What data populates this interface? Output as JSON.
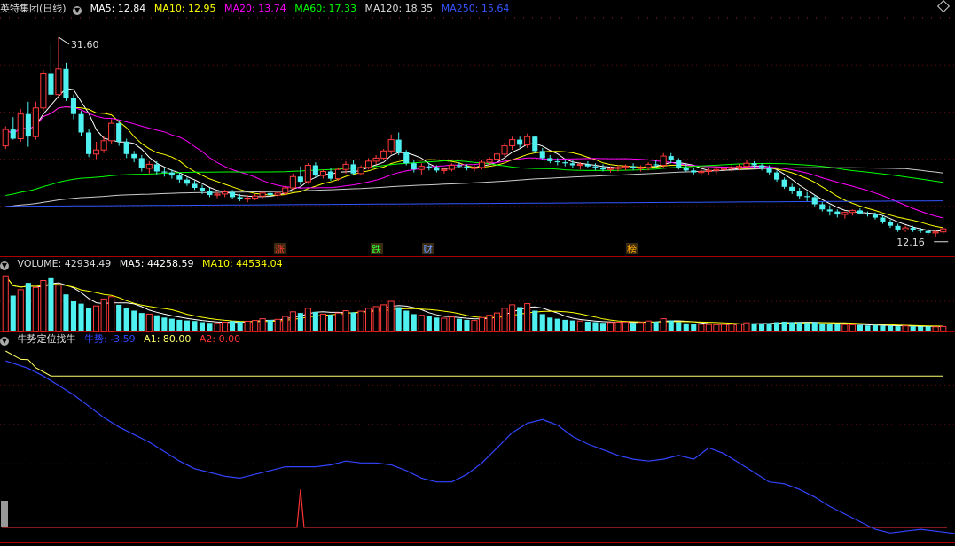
{
  "chart_data": [
    {
      "type": "candlestick",
      "title": "英特集团(日线)",
      "indicators": [
        {
          "label": "MA5: 12.84",
          "color": "#ffffff"
        },
        {
          "label": "MA10: 12.95",
          "color": "#ffff00"
        },
        {
          "label": "MA20: 13.74",
          "color": "#ff00ff"
        },
        {
          "label": "MA60: 17.33",
          "color": "#00ff00"
        },
        {
          "label": "MA120: 18.35",
          "color": "#dddddd"
        },
        {
          "label": "MA250: 15.64",
          "color": "#3355ff"
        }
      ],
      "high_label": "31.60",
      "low_label": "12.16",
      "event_markers": [
        {
          "label": "涨",
          "color": "#ff3333"
        },
        {
          "label": "跌",
          "color": "#33ff33"
        },
        {
          "label": "财",
          "color": "#6699ff"
        },
        {
          "label": "榜",
          "color": "#ffaa00"
        }
      ],
      "ylim": [
        10.5,
        33.5
      ],
      "ohlc": [
        [
          21.0,
          22.9,
          20.7,
          22.6
        ],
        [
          22.6,
          23.8,
          21.6,
          21.7
        ],
        [
          21.7,
          24.6,
          21.4,
          24.1
        ],
        [
          24.1,
          25.3,
          20.9,
          21.9
        ],
        [
          21.9,
          25.3,
          21.6,
          24.7
        ],
        [
          24.7,
          28.4,
          24.4,
          28.1
        ],
        [
          28.1,
          30.9,
          25.8,
          26.0
        ],
        [
          26.0,
          31.6,
          25.8,
          28.5
        ],
        [
          28.5,
          29.1,
          25.4,
          25.7
        ],
        [
          25.7,
          26.0,
          23.6,
          24.1
        ],
        [
          24.1,
          24.4,
          22.0,
          22.3
        ],
        [
          22.3,
          22.6,
          19.9,
          20.2
        ],
        [
          20.2,
          21.4,
          19.7,
          20.6
        ],
        [
          20.6,
          21.9,
          20.3,
          21.5
        ],
        [
          21.5,
          23.6,
          21.2,
          23.2
        ],
        [
          23.2,
          23.5,
          21.0,
          21.4
        ],
        [
          21.4,
          21.7,
          19.8,
          20.2
        ],
        [
          20.2,
          20.5,
          19.4,
          19.8
        ],
        [
          19.8,
          20.1,
          18.5,
          18.8
        ],
        [
          18.8,
          19.5,
          18.3,
          19.2
        ],
        [
          19.2,
          19.5,
          18.2,
          18.5
        ],
        [
          18.5,
          18.8,
          18.0,
          18.4
        ],
        [
          18.4,
          18.7,
          17.8,
          18.1
        ],
        [
          18.1,
          18.4,
          17.4,
          17.7
        ],
        [
          17.7,
          17.9,
          17.1,
          17.3
        ],
        [
          17.3,
          17.6,
          16.7,
          16.9
        ],
        [
          16.9,
          17.2,
          16.3,
          16.6
        ],
        [
          16.6,
          16.9,
          16.0,
          16.2
        ],
        [
          16.2,
          16.5,
          15.9,
          16.3
        ],
        [
          16.3,
          16.7,
          16.0,
          16.5
        ],
        [
          16.5,
          16.7,
          15.8,
          16.0
        ],
        [
          16.0,
          16.3,
          15.6,
          15.8
        ],
        [
          15.8,
          16.2,
          15.5,
          15.9
        ],
        [
          15.9,
          16.3,
          15.7,
          16.1
        ],
        [
          16.1,
          16.6,
          15.9,
          16.4
        ],
        [
          16.4,
          16.7,
          16.0,
          16.2
        ],
        [
          16.2,
          16.6,
          15.9,
          16.4
        ],
        [
          16.4,
          17.1,
          16.2,
          16.9
        ],
        [
          16.9,
          18.3,
          16.7,
          18.0
        ],
        [
          18.0,
          19.0,
          17.2,
          17.5
        ],
        [
          17.5,
          19.3,
          17.3,
          19.1
        ],
        [
          19.1,
          19.4,
          17.9,
          18.1
        ],
        [
          18.1,
          18.7,
          17.8,
          18.5
        ],
        [
          18.5,
          18.8,
          17.6,
          17.8
        ],
        [
          17.8,
          18.9,
          17.6,
          18.7
        ],
        [
          18.7,
          19.5,
          18.3,
          19.2
        ],
        [
          19.2,
          19.6,
          18.1,
          18.3
        ],
        [
          18.3,
          19.1,
          18.1,
          18.9
        ],
        [
          18.9,
          19.8,
          18.7,
          19.5
        ],
        [
          19.5,
          20.1,
          19.2,
          19.8
        ],
        [
          19.8,
          20.7,
          19.6,
          20.5
        ],
        [
          20.5,
          22.1,
          20.2,
          21.6
        ],
        [
          21.6,
          22.3,
          20.1,
          20.4
        ],
        [
          20.4,
          20.6,
          19.1,
          19.3
        ],
        [
          19.3,
          19.6,
          18.4,
          18.7
        ],
        [
          18.7,
          19.3,
          18.2,
          19.0
        ],
        [
          19.0,
          19.3,
          18.6,
          18.9
        ],
        [
          18.9,
          19.1,
          18.4,
          18.6
        ],
        [
          18.6,
          18.9,
          18.3,
          18.7
        ],
        [
          18.7,
          19.3,
          18.5,
          19.1
        ],
        [
          19.1,
          19.4,
          18.8,
          19.0
        ],
        [
          19.0,
          19.2,
          18.6,
          18.8
        ],
        [
          18.8,
          19.1,
          18.5,
          18.9
        ],
        [
          18.9,
          19.6,
          18.7,
          19.4
        ],
        [
          19.4,
          19.9,
          19.1,
          19.7
        ],
        [
          19.7,
          20.4,
          19.5,
          20.2
        ],
        [
          20.2,
          21.3,
          19.9,
          21.0
        ],
        [
          21.0,
          21.9,
          20.6,
          21.6
        ],
        [
          21.6,
          21.9,
          20.8,
          21.1
        ],
        [
          21.1,
          22.2,
          20.8,
          21.9
        ],
        [
          21.9,
          22.0,
          20.3,
          20.5
        ],
        [
          20.5,
          20.8,
          19.6,
          19.8
        ],
        [
          19.8,
          20.1,
          19.3,
          19.5
        ],
        [
          19.5,
          19.8,
          19.1,
          19.4
        ],
        [
          19.4,
          19.7,
          19.0,
          19.3
        ],
        [
          19.3,
          19.6,
          18.8,
          19.1
        ],
        [
          19.1,
          19.4,
          18.7,
          19.2
        ],
        [
          19.2,
          19.5,
          18.9,
          19.0
        ],
        [
          19.0,
          19.3,
          18.6,
          18.9
        ],
        [
          18.9,
          19.2,
          18.5,
          18.7
        ],
        [
          18.7,
          19.0,
          18.4,
          18.8
        ],
        [
          18.8,
          19.1,
          18.5,
          18.9
        ],
        [
          18.9,
          19.2,
          18.6,
          19.0
        ],
        [
          19.0,
          19.3,
          18.6,
          18.8
        ],
        [
          18.8,
          19.1,
          18.5,
          18.9
        ],
        [
          18.9,
          19.4,
          18.6,
          19.2
        ],
        [
          19.2,
          19.6,
          18.9,
          19.1
        ],
        [
          19.1,
          20.3,
          18.8,
          20.0
        ],
        [
          20.0,
          20.3,
          19.3,
          19.6
        ],
        [
          19.6,
          19.8,
          18.7,
          18.9
        ],
        [
          18.9,
          19.2,
          18.5,
          18.6
        ],
        [
          18.6,
          18.8,
          18.2,
          18.4
        ],
        [
          18.4,
          18.7,
          18.1,
          18.5
        ],
        [
          18.5,
          18.8,
          18.2,
          18.6
        ],
        [
          18.6,
          18.9,
          18.3,
          18.7
        ],
        [
          18.7,
          19.0,
          18.4,
          18.8
        ],
        [
          18.8,
          19.1,
          18.5,
          18.9
        ],
        [
          18.9,
          19.2,
          18.6,
          19.0
        ],
        [
          19.0,
          19.6,
          18.8,
          19.3
        ],
        [
          19.3,
          19.5,
          18.9,
          19.1
        ],
        [
          19.1,
          19.3,
          18.6,
          18.9
        ],
        [
          18.9,
          19.1,
          18.2,
          18.4
        ],
        [
          18.4,
          18.6,
          17.5,
          17.7
        ],
        [
          17.7,
          17.9,
          16.8,
          17.0
        ],
        [
          17.0,
          17.3,
          16.3,
          16.6
        ],
        [
          16.6,
          16.9,
          15.8,
          16.1
        ],
        [
          16.1,
          16.5,
          15.6,
          16.0
        ],
        [
          16.0,
          16.2,
          15.1,
          15.3
        ],
        [
          15.3,
          15.5,
          14.6,
          14.8
        ],
        [
          14.8,
          15.2,
          14.2,
          14.6
        ],
        [
          14.6,
          14.8,
          14.0,
          14.3
        ],
        [
          14.3,
          14.6,
          13.9,
          14.5
        ],
        [
          14.5,
          14.8,
          14.2,
          14.7
        ],
        [
          14.7,
          14.9,
          14.3,
          14.4
        ],
        [
          14.4,
          14.6,
          14.1,
          14.3
        ],
        [
          14.3,
          14.5,
          13.8,
          14.0
        ],
        [
          14.0,
          14.2,
          13.4,
          13.6
        ],
        [
          13.6,
          13.8,
          13.0,
          13.2
        ],
        [
          13.2,
          13.4,
          12.6,
          12.8
        ],
        [
          12.8,
          13.2,
          12.6,
          13.0
        ],
        [
          13.0,
          13.2,
          12.6,
          12.8
        ],
        [
          12.8,
          13.0,
          12.5,
          12.7
        ],
        [
          12.7,
          12.9,
          12.3,
          12.5
        ],
        [
          12.5,
          12.8,
          12.16,
          12.6
        ],
        [
          12.6,
          13.0,
          12.4,
          12.9
        ]
      ],
      "ma250": {
        "start": 15.1,
        "end": 15.64
      }
    },
    {
      "type": "bar",
      "title": "VOLUME",
      "indicators": [
        {
          "label": "VOLUME: 42934.49",
          "color": "#dddddd"
        },
        {
          "label": "MA5: 44258.59",
          "color": "#ffffff"
        },
        {
          "label": "MA10: 44534.04",
          "color": "#ffff00"
        }
      ],
      "ylim": [
        0,
        520000
      ],
      "values": [
        480000,
        310000,
        360000,
        420000,
        380000,
        440000,
        460000,
        400000,
        320000,
        260000,
        240000,
        200000,
        220000,
        280000,
        300000,
        230000,
        200000,
        180000,
        160000,
        150000,
        140000,
        120000,
        110000,
        100000,
        95000,
        90000,
        80000,
        75000,
        70000,
        80000,
        90000,
        85000,
        88000,
        95000,
        110000,
        100000,
        105000,
        130000,
        170000,
        160000,
        200000,
        170000,
        150000,
        145000,
        160000,
        180000,
        165000,
        175000,
        200000,
        215000,
        230000,
        260000,
        210000,
        180000,
        150000,
        140000,
        130000,
        120000,
        115000,
        125000,
        110000,
        100000,
        95000,
        120000,
        140000,
        160000,
        200000,
        230000,
        210000,
        240000,
        180000,
        150000,
        120000,
        110000,
        100000,
        95000,
        90000,
        85000,
        80000,
        75000,
        78000,
        80000,
        82000,
        75000,
        78000,
        90000,
        85000,
        110000,
        95000,
        80000,
        70000,
        65000,
        62000,
        60000,
        58000,
        60000,
        62000,
        64000,
        75000,
        70000,
        68000,
        72000,
        80000,
        85000,
        80000,
        78000,
        75000,
        80000,
        70000,
        68000,
        65000,
        60000,
        58000,
        55000,
        52000,
        55000,
        50000,
        48000,
        45000,
        48000,
        44000,
        42000,
        43000,
        40000,
        42934
      ]
    },
    {
      "type": "line",
      "title": "牛势定位找牛",
      "indicators": [
        {
          "label": "牛势: -3.59",
          "color": "#3344ff"
        },
        {
          "label": "A1: 80.00",
          "color": "#ffff66"
        },
        {
          "label": "A2: 0.00",
          "color": "#ff3333"
        }
      ],
      "ylim": [
        -8,
        96
      ],
      "a1": 80,
      "a2": 0,
      "series_points": [
        [
          0,
          88
        ],
        [
          3,
          84
        ],
        [
          5,
          80
        ],
        [
          7,
          75
        ],
        [
          9,
          70
        ],
        [
          11,
          64
        ],
        [
          13,
          58
        ],
        [
          15,
          53
        ],
        [
          17,
          49
        ],
        [
          19,
          45
        ],
        [
          21,
          40
        ],
        [
          23,
          35
        ],
        [
          25,
          31
        ],
        [
          27,
          29
        ],
        [
          29,
          27
        ],
        [
          31,
          26
        ],
        [
          33,
          28
        ],
        [
          35,
          30
        ],
        [
          37,
          32
        ],
        [
          39,
          32
        ],
        [
          41,
          32
        ],
        [
          43,
          33
        ],
        [
          45,
          35
        ],
        [
          47,
          34
        ],
        [
          49,
          34
        ],
        [
          51,
          33
        ],
        [
          53,
          30
        ],
        [
          55,
          26
        ],
        [
          57,
          24
        ],
        [
          59,
          24
        ],
        [
          61,
          28
        ],
        [
          63,
          34
        ],
        [
          65,
          42
        ],
        [
          67,
          50
        ],
        [
          69,
          55
        ],
        [
          71,
          57
        ],
        [
          73,
          54
        ],
        [
          75,
          48
        ],
        [
          77,
          44
        ],
        [
          79,
          41
        ],
        [
          81,
          38
        ],
        [
          83,
          36
        ],
        [
          85,
          35
        ],
        [
          87,
          36
        ],
        [
          89,
          38
        ],
        [
          91,
          36
        ],
        [
          93,
          42
        ],
        [
          95,
          39
        ],
        [
          97,
          34
        ],
        [
          99,
          29
        ],
        [
          101,
          24
        ],
        [
          103,
          23
        ],
        [
          105,
          20
        ],
        [
          107,
          16
        ],
        [
          109,
          11
        ],
        [
          111,
          7
        ],
        [
          113,
          3
        ],
        [
          115,
          -1
        ],
        [
          117,
          -3
        ],
        [
          119,
          -2
        ],
        [
          121,
          -1
        ],
        [
          123,
          -2
        ],
        [
          125,
          -3
        ],
        [
          126,
          -3.59
        ]
      ],
      "spike": {
        "index": 39,
        "value": 20
      }
    }
  ],
  "icons": {
    "settings": "gear-icon",
    "layout": "diamond-icon"
  }
}
